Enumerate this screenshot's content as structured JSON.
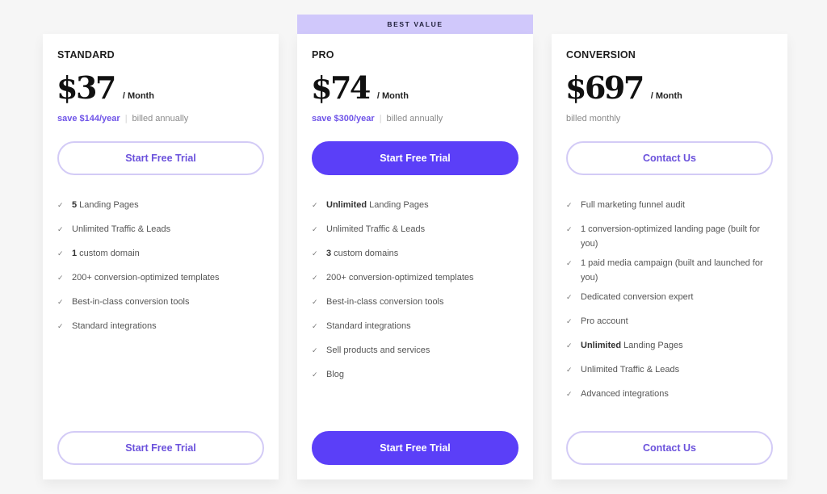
{
  "colors": {
    "accent": "#5b3ff8",
    "accent_text": "#6b52dc",
    "outline_border": "#d3cbf6",
    "badge_bg": "#d0c8fb",
    "page_bg": "#f6f6f6"
  },
  "plans": [
    {
      "name": "STANDARD",
      "price": "$37",
      "per": "/ Month",
      "save": "save $144/year",
      "separator": "|",
      "billing": "billed annually",
      "cta": "Start Free Trial",
      "features": [
        {
          "bold": "5",
          "text": " Landing Pages"
        },
        {
          "bold": "",
          "text": "Unlimited Traffic & Leads"
        },
        {
          "bold": "1",
          "text": " custom domain"
        },
        {
          "bold": "",
          "text": "200+ conversion-optimized templates"
        },
        {
          "bold": "",
          "text": "Best-in-class conversion tools"
        },
        {
          "bold": "",
          "text": "Standard integrations"
        }
      ]
    },
    {
      "badge": "BEST VALUE",
      "name": "PRO",
      "price": "$74",
      "per": "/ Month",
      "save": "save $300/year",
      "separator": "|",
      "billing": "billed annually",
      "cta": "Start Free Trial",
      "features": [
        {
          "bold": "Unlimited",
          "text": " Landing Pages"
        },
        {
          "bold": "",
          "text": "Unlimited Traffic & Leads"
        },
        {
          "bold": "3",
          "text": " custom domains"
        },
        {
          "bold": "",
          "text": "200+ conversion-optimized templates"
        },
        {
          "bold": "",
          "text": "Best-in-class conversion tools"
        },
        {
          "bold": "",
          "text": "Standard integrations"
        },
        {
          "bold": "",
          "text": "Sell products and services"
        },
        {
          "bold": "",
          "text": "Blog"
        }
      ]
    },
    {
      "name": "CONVERSION",
      "price": "$697",
      "per": "/ Month",
      "billing": "billed monthly",
      "cta": "Contact Us",
      "features": [
        {
          "bold": "",
          "text": "Full marketing funnel audit"
        },
        {
          "bold": "",
          "text": "1 conversion-optimized landing page (built for you)"
        },
        {
          "bold": "",
          "text": "1 paid media campaign (built and launched for you)"
        },
        {
          "bold": "",
          "text": "Dedicated conversion expert"
        },
        {
          "bold": "",
          "text": "Pro account"
        },
        {
          "bold": "Unlimited",
          "text": " Landing Pages"
        },
        {
          "bold": "",
          "text": "Unlimited Traffic & Leads"
        },
        {
          "bold": "",
          "text": "Advanced integrations"
        }
      ]
    }
  ],
  "icons": {
    "feature_check": "✓"
  }
}
